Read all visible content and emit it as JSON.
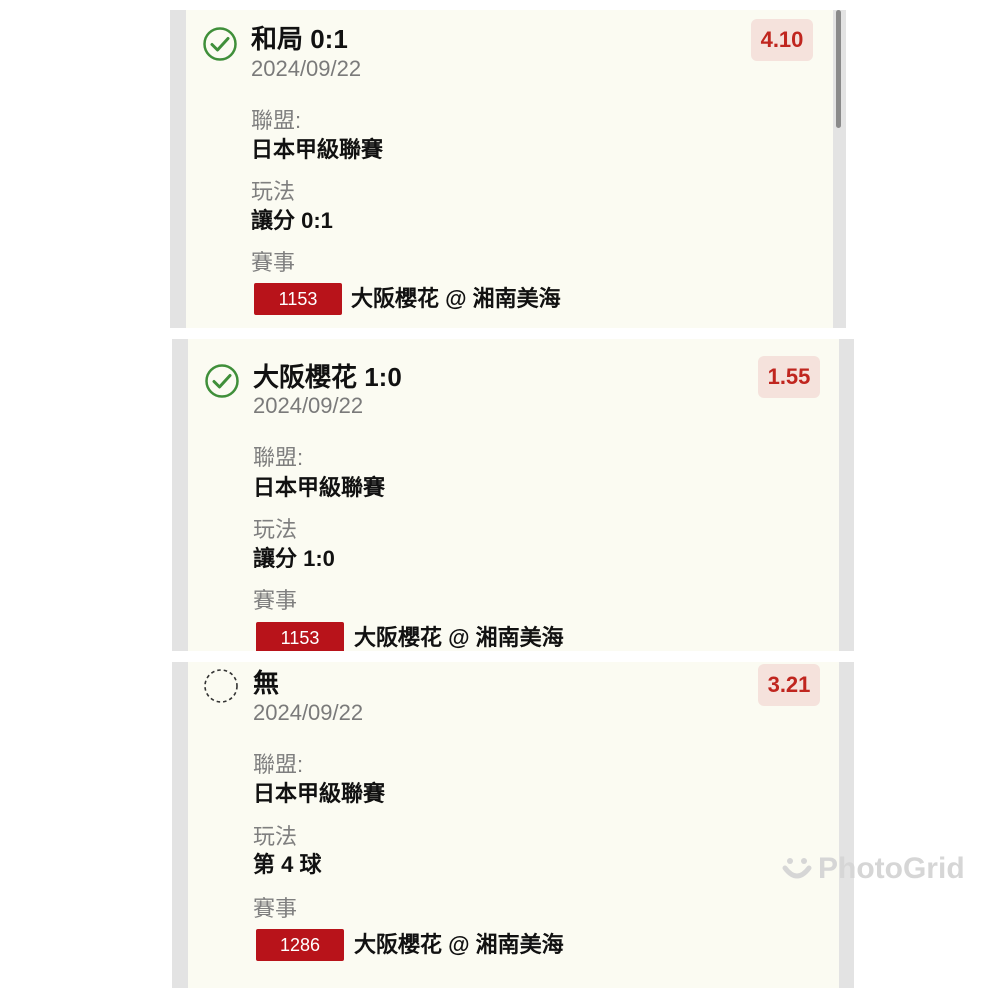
{
  "cards": [
    {
      "status": "won",
      "status_icon": "check-circle-icon",
      "title": "和局 0:1",
      "date": "2024/09/22",
      "odds": "4.10",
      "league_label": "聯盟:",
      "league": "日本甲級聯賽",
      "play_label": "玩法",
      "play": "讓分 0:1",
      "match_label": "賽事",
      "match_id": "1153",
      "match": "大阪櫻花 @ 湘南美海"
    },
    {
      "status": "won",
      "status_icon": "check-circle-icon",
      "title": "大阪櫻花 1:0",
      "date": "2024/09/22",
      "odds": "1.55",
      "league_label": "聯盟:",
      "league": "日本甲級聯賽",
      "play_label": "玩法",
      "play": "讓分 1:0",
      "match_label": "賽事",
      "match_id": "1153",
      "match": "大阪櫻花 @ 湘南美海"
    },
    {
      "status": "pending",
      "status_icon": "dashed-circle-icon",
      "title": "無",
      "date": "2024/09/22",
      "odds": "3.21",
      "league_label": "聯盟:",
      "league": "日本甲級聯賽",
      "play_label": "玩法",
      "play": "第 4 球",
      "match_label": "賽事",
      "match_id": "1286",
      "match": "大阪櫻花 @ 湘南美海"
    }
  ],
  "colors": {
    "card_bg": "#fbfbf2",
    "odds_text": "#c0261f",
    "odds_bg": "#f5e2dc",
    "match_id_bg": "#b8131a",
    "check_green": "#3f8f3a"
  },
  "watermark": {
    "text": "PhotoGrid"
  }
}
